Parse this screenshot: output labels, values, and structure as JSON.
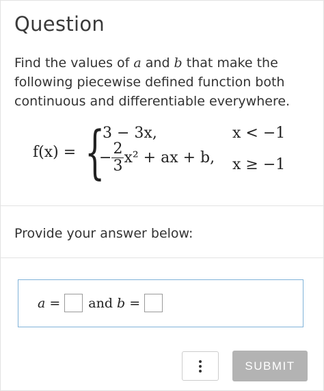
{
  "question": {
    "title": "Question",
    "prompt_parts": [
      "Find the values of ",
      "a",
      " and ",
      "b",
      " that make the following piecewise defined function both continuous and differentiable everywhere."
    ],
    "function": {
      "lhs": "f(x) =",
      "case1_expr": "3 − 3x,",
      "case1_cond": "x < −1",
      "case2_sign": "−",
      "case2_frac_num": "2",
      "case2_frac_den": "3",
      "case2_rest": "x² + ax + b,",
      "case2_cond": "x ≥ −1"
    }
  },
  "answer": {
    "heading": "Provide your answer below:",
    "a_label": "a =",
    "and_label": "and",
    "b_label": "b ="
  },
  "actions": {
    "more_icon": "vertical-dots-icon",
    "submit_label": "SUBMIT",
    "submit_color": "#b3b3b3"
  }
}
